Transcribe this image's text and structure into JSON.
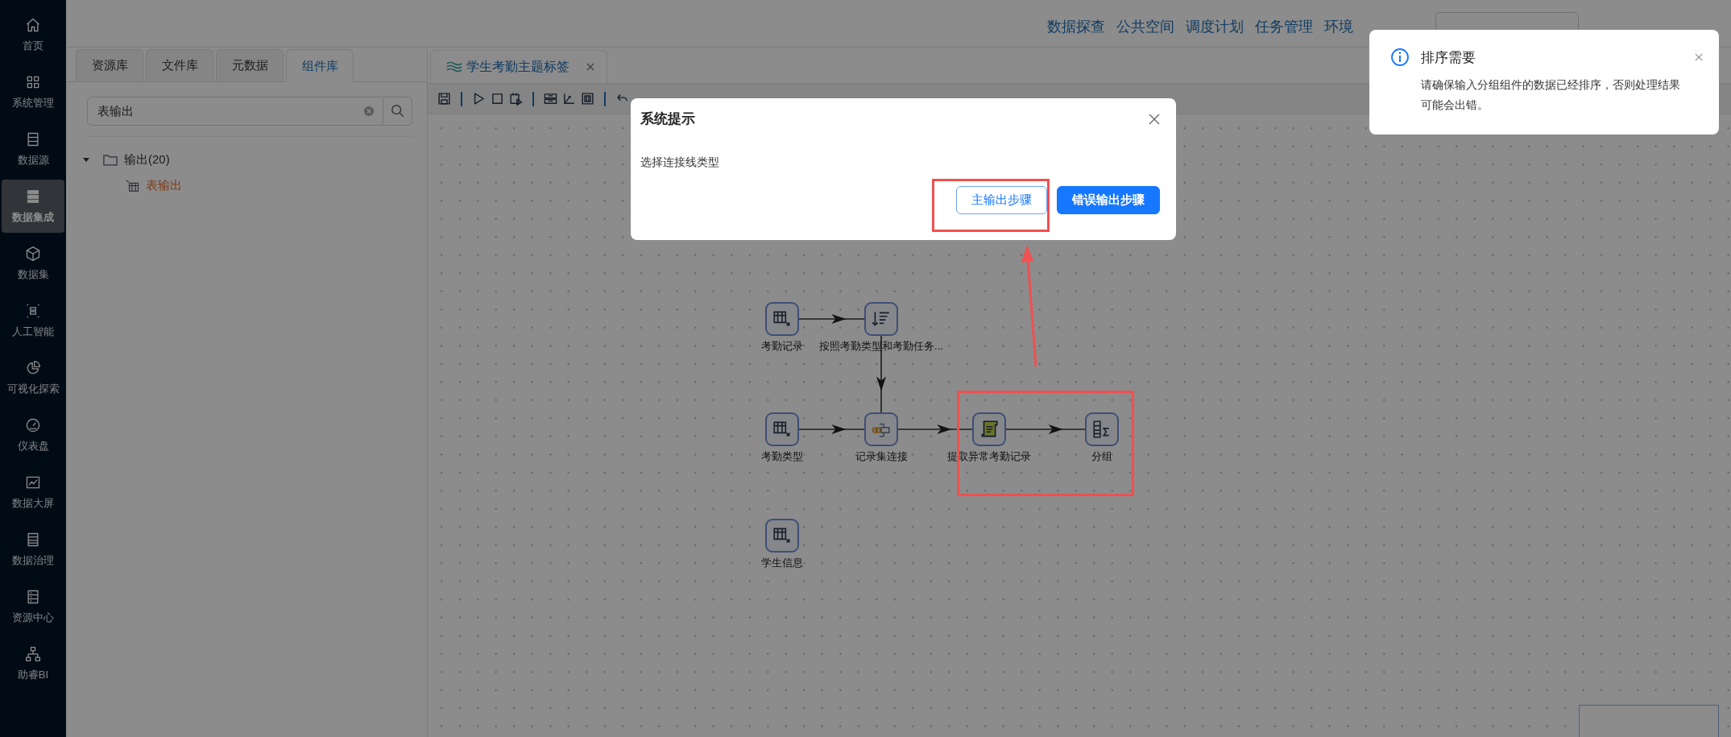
{
  "header_menu": [
    {
      "label": "数据探查"
    },
    {
      "label": "公共空间"
    },
    {
      "label": "调度计划"
    },
    {
      "label": "任务管理"
    },
    {
      "label": "环境"
    }
  ],
  "sidebar": {
    "items": [
      {
        "label": "首页",
        "selected": false
      },
      {
        "label": "系统管理",
        "selected": false
      },
      {
        "label": "数据源",
        "selected": false
      },
      {
        "label": "数据集成",
        "selected": true
      },
      {
        "label": "数据集",
        "selected": false
      },
      {
        "label": "人工智能",
        "selected": false
      },
      {
        "label": "可视化探索",
        "selected": false
      },
      {
        "label": "仪表盘",
        "selected": false
      },
      {
        "label": "数据大屏",
        "selected": false
      },
      {
        "label": "数据治理",
        "selected": false
      },
      {
        "label": "资源中心",
        "selected": false
      },
      {
        "label": "助睿BI",
        "selected": false
      }
    ]
  },
  "left_panel": {
    "tabs": [
      {
        "label": "资源库",
        "selected": false
      },
      {
        "label": "文件库",
        "selected": false
      },
      {
        "label": "元数据",
        "selected": false
      },
      {
        "label": "组件库",
        "selected": true
      }
    ],
    "search": {
      "value": "表输出"
    },
    "tree": [
      {
        "label": "输出(20)",
        "expanded": true,
        "children": [
          {
            "label": "表输出",
            "matched": true
          }
        ]
      }
    ]
  },
  "editor_tabs": [
    {
      "label": "学生考勤主题标签",
      "selected": true
    }
  ],
  "diagram": {
    "nodes": [
      {
        "label": "考勤记录",
        "kind": "table_input"
      },
      {
        "label": "按照考勤类型和考勤任务...",
        "kind": "sort"
      },
      {
        "label": "考勤类型",
        "kind": "table_input"
      },
      {
        "label": "记录集连接",
        "kind": "join"
      },
      {
        "label": "提取异常考勤记录",
        "kind": "script"
      },
      {
        "label": "分组",
        "kind": "group_by"
      },
      {
        "label": "学生信息",
        "kind": "table_input"
      }
    ]
  },
  "dialog": {
    "title": "系统提示",
    "message": "选择连接线类型",
    "buttons": [
      {
        "label": "主输出步骤",
        "kind": "default"
      },
      {
        "label": "错误输出步骤",
        "kind": "primary"
      }
    ]
  },
  "notification": {
    "title": "排序需要",
    "message": "请确保输入分组组件的数据已经排序，否则处理结果可能会出错。"
  }
}
